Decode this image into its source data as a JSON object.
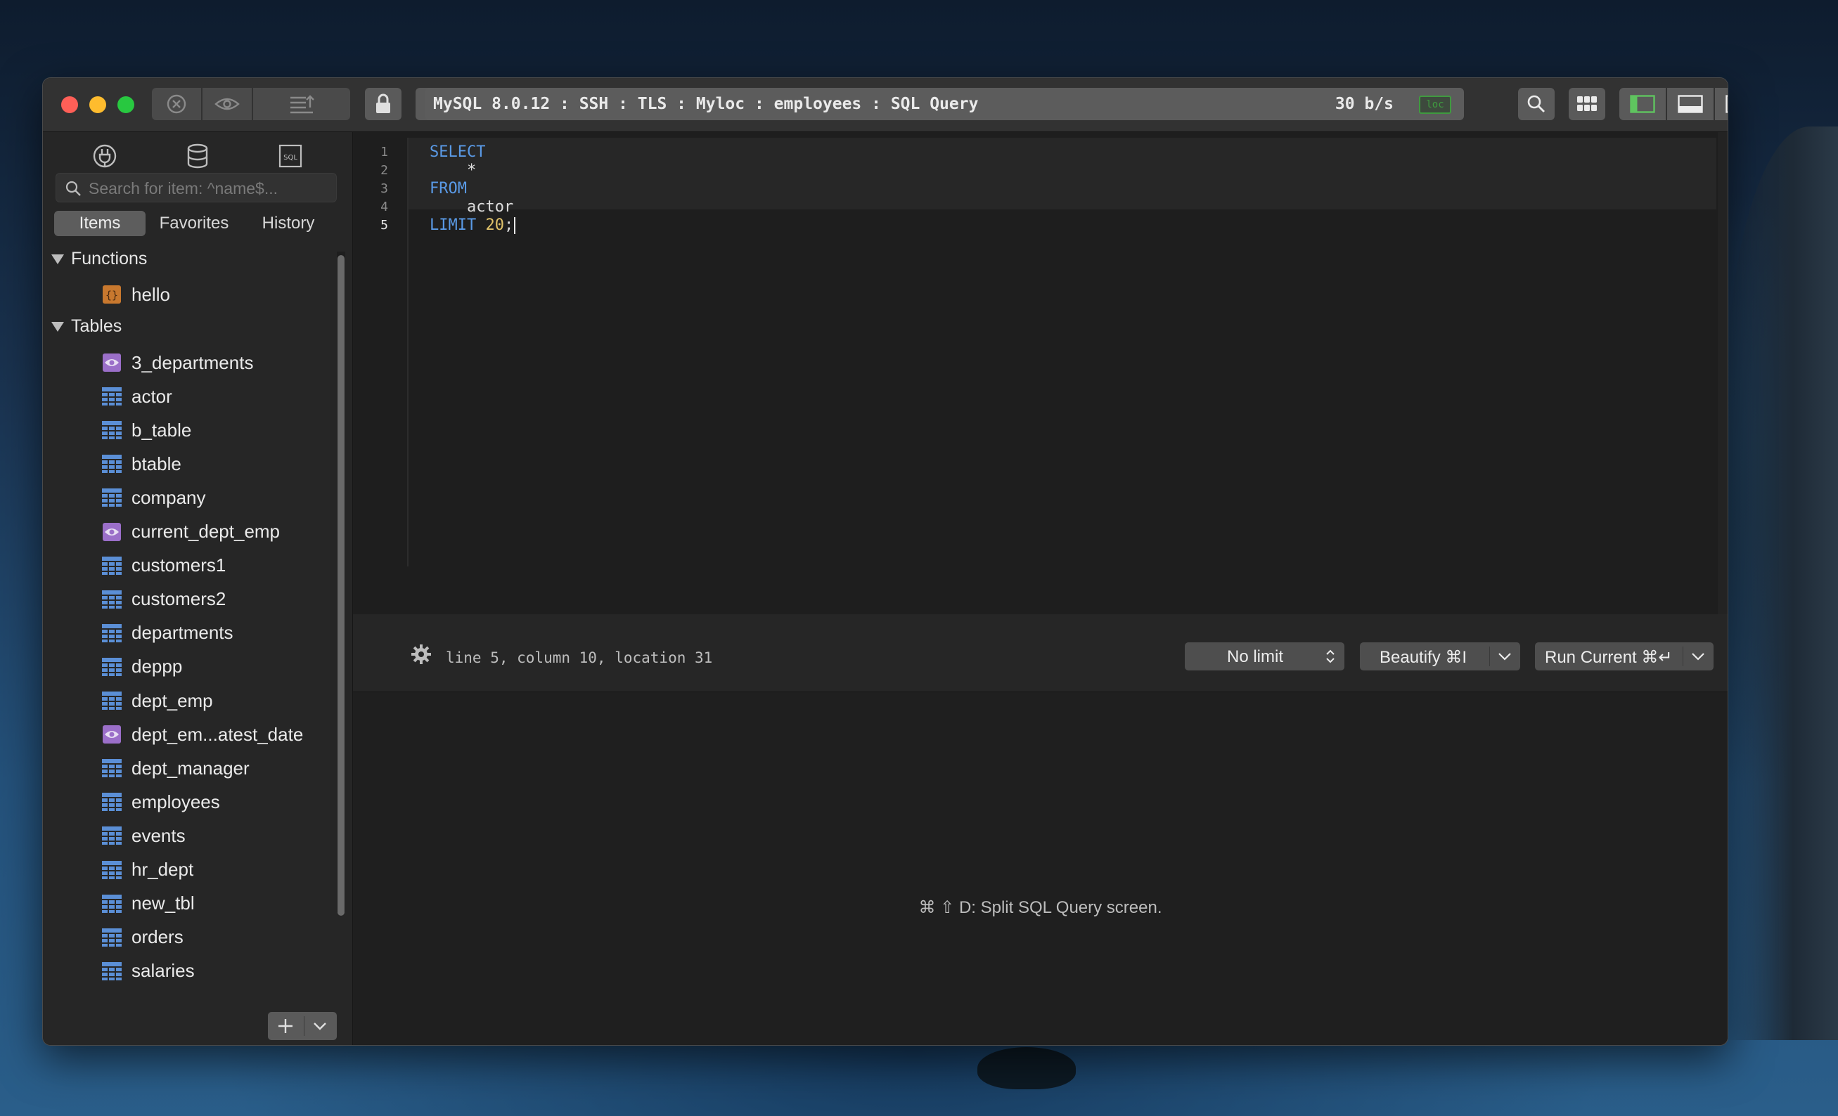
{
  "window": {
    "connection": "MySQL 8.0.12 : SSH : TLS : Myloc : employees : SQL Query",
    "rate": "30 b/s",
    "loc_badge": "loc"
  },
  "sidebar": {
    "search_placeholder": "Search for item: ^name$...",
    "tabs": [
      "Items",
      "Favorites",
      "History"
    ],
    "active_tab": "Items",
    "sections": [
      {
        "label": "Functions",
        "items": [
          {
            "name": "hello",
            "type": "function"
          }
        ]
      },
      {
        "label": "Tables",
        "items": [
          {
            "name": "3_departments",
            "type": "view"
          },
          {
            "name": "actor",
            "type": "table"
          },
          {
            "name": "b_table",
            "type": "table"
          },
          {
            "name": "btable",
            "type": "table"
          },
          {
            "name": "company",
            "type": "table"
          },
          {
            "name": "current_dept_emp",
            "type": "view"
          },
          {
            "name": "customers1",
            "type": "table"
          },
          {
            "name": "customers2",
            "type": "table"
          },
          {
            "name": "departments",
            "type": "table"
          },
          {
            "name": "deppp",
            "type": "table"
          },
          {
            "name": "dept_emp",
            "type": "table"
          },
          {
            "name": "dept_em...atest_date",
            "type": "view"
          },
          {
            "name": "dept_manager",
            "type": "table"
          },
          {
            "name": "employees",
            "type": "table"
          },
          {
            "name": "events",
            "type": "table"
          },
          {
            "name": "hr_dept",
            "type": "table"
          },
          {
            "name": "new_tbl",
            "type": "table"
          },
          {
            "name": "orders",
            "type": "table"
          },
          {
            "name": "salaries",
            "type": "table"
          }
        ]
      }
    ]
  },
  "editor": {
    "line_numbers": [
      "1",
      "2",
      "3",
      "4",
      "5"
    ],
    "lines": [
      [
        {
          "t": "SELECT",
          "c": "kw"
        }
      ],
      [
        {
          "t": "    *",
          "c": "plain"
        }
      ],
      [
        {
          "t": "FROM",
          "c": "kw"
        }
      ],
      [
        {
          "t": "    actor",
          "c": "plain"
        }
      ],
      [
        {
          "t": "LIMIT ",
          "c": "kw"
        },
        {
          "t": "20",
          "c": "num"
        },
        {
          "t": ";",
          "c": "plain"
        }
      ]
    ],
    "status": "line 5, column 10, location 31",
    "limit_label": "No limit",
    "beautify_label": "Beautify ⌘I",
    "run_label": "Run Current ⌘↵"
  },
  "results": {
    "hint": "⌘ ⇧ D: Split SQL Query screen."
  },
  "colors": {
    "keyword": "#5a9ae6",
    "number": "#e0c26a",
    "table_icon": "#5b8fd6",
    "view_icon": "#9b6fc9",
    "function_icon": "#c8782e",
    "loc_badge": "#3f9a3f"
  }
}
